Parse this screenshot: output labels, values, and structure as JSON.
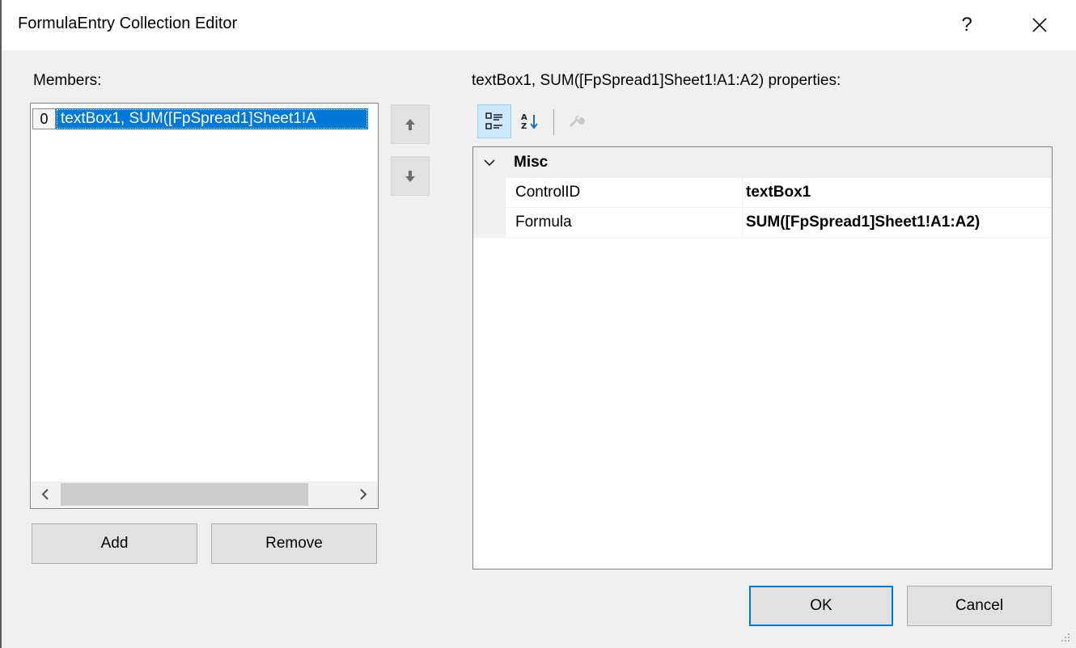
{
  "window": {
    "title": "FormulaEntry Collection Editor",
    "help_glyph": "?",
    "close_glyph": "✕"
  },
  "members": {
    "label": "Members:",
    "items": [
      {
        "index": "0",
        "text": "textBox1, SUM([FpSpread1]Sheet1!A"
      }
    ],
    "scroll_left": "<",
    "scroll_right": ">"
  },
  "buttons": {
    "add": "Add",
    "remove": "Remove",
    "ok": "OK",
    "cancel": "Cancel"
  },
  "properties": {
    "label": "textBox1, SUM([FpSpread1]Sheet1!A1:A2) properties:",
    "category": "Misc",
    "rows": [
      {
        "name": "ControlID",
        "value": "textBox1"
      },
      {
        "name": "Formula",
        "value": "SUM([FpSpread1]Sheet1!A1:A2)"
      }
    ]
  },
  "toolbar": {
    "items": [
      "categorized-icon",
      "alphabetical-icon",
      "property-pages-icon"
    ]
  },
  "colors": {
    "selection": "#0078d7",
    "dialog_bg": "#f0f0f0",
    "pressed_tool": "#cce8ff"
  }
}
